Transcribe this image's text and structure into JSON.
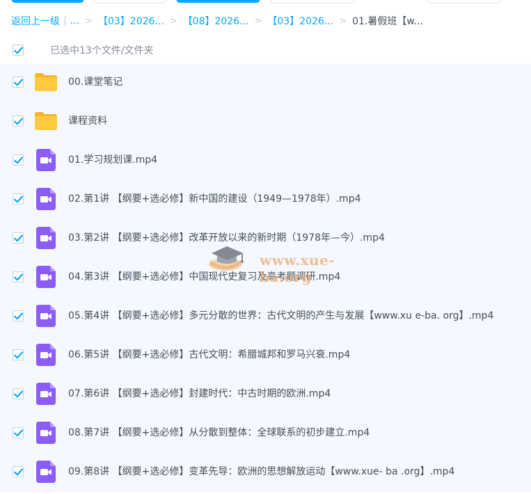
{
  "breadcrumb": {
    "back": "返回上一级",
    "separator_bar": "|",
    "ellipsis": "...",
    "crumbs": [
      "【03】2026...",
      "【08】2026...",
      "【03】2026..."
    ],
    "current": "01.暑假班【w..."
  },
  "selection": {
    "status": "已选中13个文件/文件夹",
    "all_checked": true
  },
  "files": [
    {
      "name": "00.课堂笔记",
      "type": "folder",
      "checked": true
    },
    {
      "name": "课程资料",
      "type": "folder",
      "checked": true
    },
    {
      "name": "01.学习规划课.mp4",
      "type": "video",
      "checked": true
    },
    {
      "name": "02.第1讲 【纲要+选必修】新中国的建设（1949—1978年）.mp4",
      "type": "video",
      "checked": true
    },
    {
      "name": "03.第2讲 【纲要+选必修】改革开放以来的新时期（1978年—今）.mp4",
      "type": "video",
      "checked": true
    },
    {
      "name": "04.第3讲 【纲要+选必修】中国现代史复习及高考题调研.mp4",
      "type": "video",
      "checked": true
    },
    {
      "name": "05.第4讲 【纲要+选必修】多元分散的世界：古代文明的产生与发展【www.xu e-ba. org】.mp4",
      "type": "video",
      "checked": true
    },
    {
      "name": "06.第5讲 【纲要+选必修】古代文明：希腊城邦和罗马兴衰.mp4",
      "type": "video",
      "checked": true
    },
    {
      "name": "07.第6讲 【纲要+选必修】封建时代：中古时期的欧洲.mp4",
      "type": "video",
      "checked": true
    },
    {
      "name": "08.第7讲 【纲要+选必修】从分散到整体：全球联系的初步建立.mp4",
      "type": "video",
      "checked": true
    },
    {
      "name": "09.第8讲 【纲要+选必修】变革先导：欧洲的思想解放运动【www.xue- ba .org】.mp4",
      "type": "video",
      "checked": true
    }
  ],
  "watermark": {
    "text": "www.xue-ba.org"
  },
  "colors": {
    "accent": "#06a7ff",
    "folder": "#ffc53d",
    "video": "#8b5cf6",
    "row_bg": "#f5f9ff"
  },
  "icons": {
    "folder": "folder-icon",
    "video": "video-file-icon",
    "check": "checkmark-icon",
    "watermark": "graduation-cap-icon"
  }
}
